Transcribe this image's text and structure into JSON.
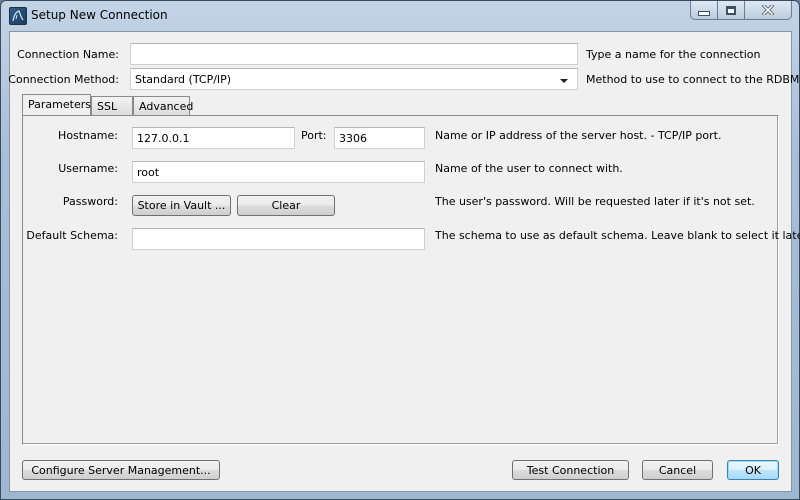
{
  "window": {
    "title": "Setup New Connection",
    "icon": "mysql-workbench-icon",
    "caption_buttons": [
      "minimize-icon",
      "maximize-icon",
      "close-icon"
    ]
  },
  "form": {
    "connection_name": {
      "label": "Connection Name:",
      "value": "",
      "hint": "Type a name for the connection"
    },
    "connection_method": {
      "label": "Connection Method:",
      "value": "Standard (TCP/IP)",
      "hint": "Method to use to connect to the RDBMS"
    }
  },
  "tabs": [
    {
      "label": "Parameters",
      "active": true
    },
    {
      "label": "SSL",
      "active": false
    },
    {
      "label": "Advanced",
      "active": false
    }
  ],
  "parameters": {
    "hostname": {
      "label": "Hostname:",
      "value": "127.0.0.1"
    },
    "port": {
      "label": "Port:",
      "value": "3306"
    },
    "hostname_hint": "Name or IP address of the server host. - TCP/IP port.",
    "username": {
      "label": "Username:",
      "value": "root",
      "hint": "Name of the user to connect with."
    },
    "password": {
      "label": "Password:",
      "store_button": "Store in Vault ...",
      "clear_button": "Clear",
      "hint": "The user's password. Will be requested later if it's not set."
    },
    "default_schema": {
      "label": "Default Schema:",
      "value": "",
      "hint": "The schema to use as default schema. Leave blank to select it later."
    }
  },
  "footer": {
    "configure_button": "Configure Server Management...",
    "test_button": "Test Connection",
    "cancel_button": "Cancel",
    "ok_button": "OK"
  }
}
